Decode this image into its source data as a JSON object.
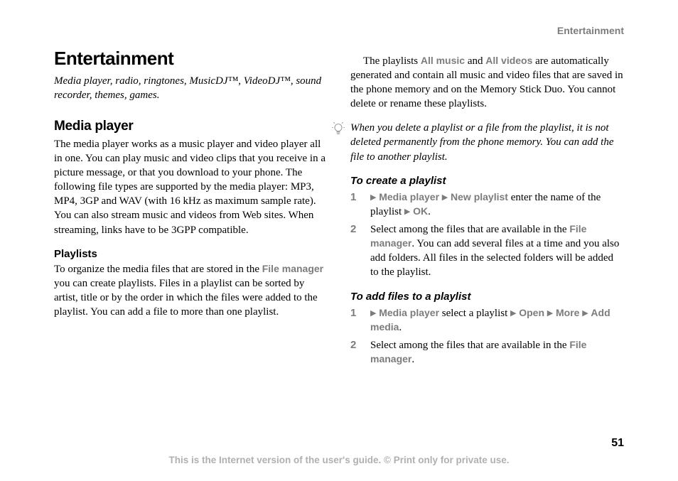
{
  "header_label": "Entertainment",
  "chapter_title": "Entertainment",
  "subtitle": "Media player, radio, ringtones, MusicDJ™, VideoDJ™, sound recorder, themes, games.",
  "media_player_heading": "Media player",
  "media_player_body": "The media player works as a music player and video player all in one. You can play music and video clips that you receive in a picture message, or that you download to your phone. The following file types are supported by the media player: MP3, MP4, 3GP and WAV (with 16 kHz as maximum sample rate). You can also stream music and videos from Web sites. When streaming, links have to be 3GPP compatible.",
  "playlists_heading": "Playlists",
  "playlists_body_1": "To organize the media files that are stored in the ",
  "file_manager_label": "File manager",
  "playlists_body_2": " you can create playlists. Files in a playlist can be sorted by artist, title or by the order in which the files were added to the playlist. You can add a file to more than one playlist.",
  "playlists_auto_1": "The playlists ",
  "all_music_label": "All music",
  "playlists_auto_2": " and ",
  "all_videos_label": "All videos",
  "playlists_auto_3": " are automatically generated and contain all music and video files that are saved in the phone memory and on the Memory Stick Duo. You cannot delete or rename these playlists.",
  "tip_text": "When you delete a playlist or a file from the playlist, it is not deleted permanently from the phone memory. You can add the file to another playlist.",
  "create_playlist_heading": "To create a playlist",
  "nav_media_player": "Media player",
  "nav_new_playlist": "New playlist",
  "create_step1_tail": " enter the name of the playlist ",
  "nav_ok": "OK",
  "create_step2_a": "Select among the files that are available in the ",
  "create_step2_b": ". You can add several files at a time and you also add folders. All files in the selected folders will be added to the playlist.",
  "add_files_heading": "To add files to a playlist",
  "add_step1_mid": " select a playlist ",
  "nav_open": "Open",
  "nav_more": "More",
  "nav_add_media": "Add media",
  "add_step2": "Select among the files that are available in the ",
  "page_num": "51",
  "footer": "This is the Internet version of the user's guide. © Print only for private use."
}
